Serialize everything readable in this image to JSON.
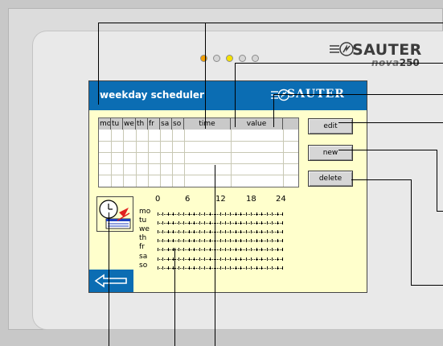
{
  "device": {
    "brand": "SAUTER",
    "model_series": "nova",
    "model_number": "250",
    "led_colors": [
      "#f5a000",
      "#d6d6d6",
      "#f5e100",
      "#d6d6d6",
      "#d6d6d6"
    ]
  },
  "screen": {
    "title": "weekday scheduler",
    "logo_text": "SAUTER",
    "table": {
      "columns": [
        "mo",
        "tu",
        "we",
        "th",
        "fr",
        "sa",
        "so",
        "time",
        "value"
      ],
      "rows": []
    },
    "buttons": {
      "edit": "edit",
      "new": "new",
      "delete": "delete"
    },
    "timeline": {
      "hours": [
        "0",
        "6",
        "12",
        "18",
        "24"
      ],
      "days": [
        "mo",
        "tu",
        "we",
        "th",
        "fr",
        "sa",
        "so"
      ]
    }
  },
  "colors": {
    "titlebar": "#0b6db3",
    "screen_background": "#ffffcc",
    "header_gray": "#c9c9c9"
  }
}
